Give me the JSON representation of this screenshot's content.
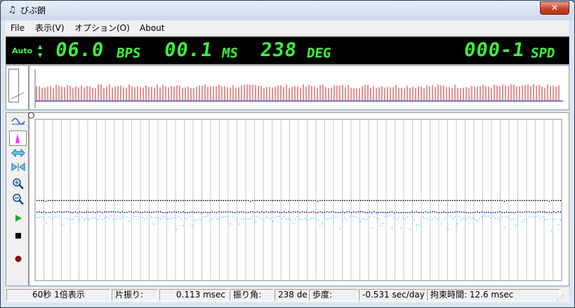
{
  "window": {
    "title": "びぶ朗",
    "close_label": "✕"
  },
  "menu": {
    "items": [
      "File",
      "表示(V)",
      "オプション(O)",
      "About"
    ]
  },
  "display": {
    "mode": "Auto",
    "bps_value": "06.0",
    "bps_unit": "BPS",
    "ms_value": "00.1",
    "ms_unit": "MS",
    "deg_value": "238",
    "deg_unit": "DEG",
    "spd_value": "000-1",
    "spd_unit": "SPD"
  },
  "toolbar": {
    "icons": [
      "wave-icon",
      "histogram-icon",
      "expand-icon",
      "compress-icon",
      "zoom-in-icon",
      "zoom-out-icon",
      "play-icon",
      "stop-icon",
      "record-icon"
    ]
  },
  "colors": {
    "lcd_green": "#3df03d",
    "wave_red": "#d02020",
    "wave_blue": "#4050c0",
    "dot_black": "#000000",
    "dot_navy": "#1a1a9a",
    "dot_cyan": "#40d8e0",
    "play_green": "#22aa22",
    "record_red": "#8a1010",
    "histogram_pink": "#ff30ff"
  },
  "status": {
    "view": "60秒 1倍表示",
    "amp_label": "片振り:",
    "amp_value": "0.113 msec",
    "angle_label": "振り角:",
    "angle_value": "238 deg",
    "rate_label": "歩度:",
    "rate_value": "-0.531 sec/day",
    "lock": "拘束時間: 12.6 msec"
  }
}
